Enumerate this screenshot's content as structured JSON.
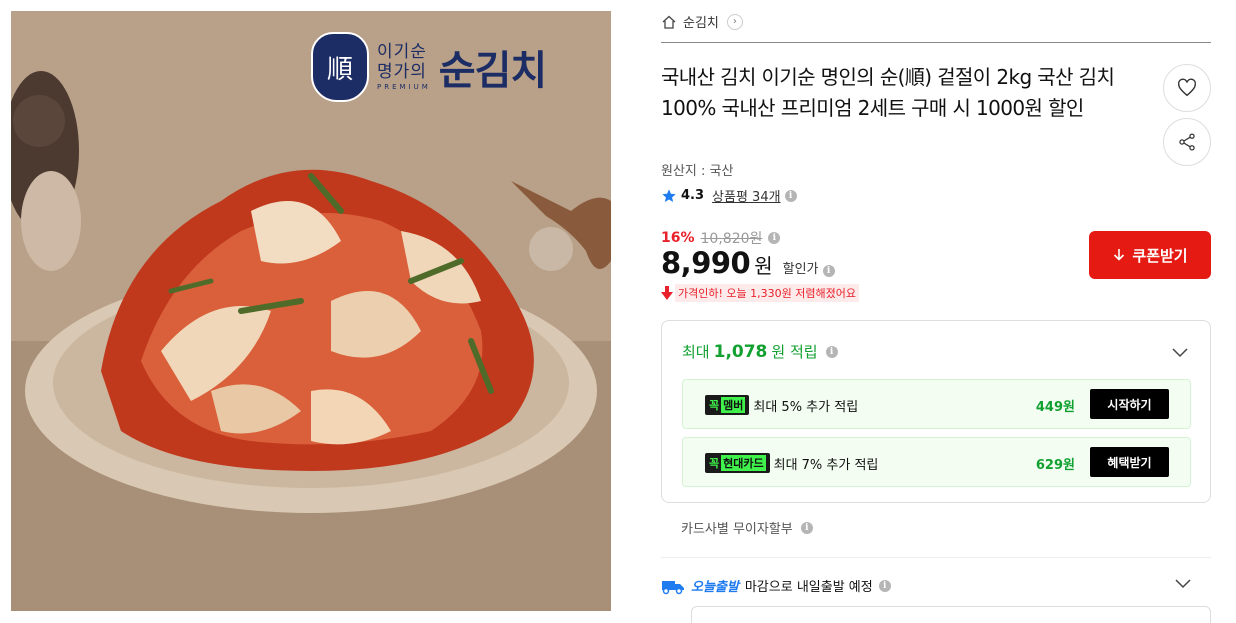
{
  "product_image": {
    "logo_main": "순김치",
    "logo_sub_line1": "이기순",
    "logo_sub_line2": "명가의",
    "logo_premium": "PREMIUM",
    "logo_seal_char": "順"
  },
  "breadcrumb": {
    "label": "순김치",
    "arrow": "›"
  },
  "product": {
    "title": "국내산 김치 이기순 명인의 순(順) 겉절이 2kg 국산 김치 100% 국내산 프리미엄 2세트 구매 시 1000원 할인",
    "origin": "원산지 : 국산",
    "rating": "4.3",
    "reviews": "상품평 34개"
  },
  "price": {
    "discount": "16%",
    "original": "10,820원",
    "sale": "8,990",
    "unit": "원",
    "sale_label": "할인가",
    "price_drop_note": "가격인하! 오늘 1,330원 저렴해졌어요"
  },
  "coupon_button": "쿠폰받기",
  "reward": {
    "prefix": "최대",
    "amount": "1,078",
    "suffix": "원 적립",
    "items": [
      {
        "badge_left": "꼭",
        "badge_right": "멤버",
        "text": "최대 5% 추가 적립",
        "amount": "449원",
        "button": "시작하기"
      },
      {
        "badge_left": "꼭",
        "badge_right": "현대카드",
        "text": "최대 7% 추가 적립",
        "amount": "629원",
        "button": "혜택받기"
      }
    ]
  },
  "installment": "카드사별 무이자할부",
  "delivery": {
    "brand": "오늘출발",
    "text": "마감으로 내일출발 예정"
  },
  "colors": {
    "accent_red": "#e51a12",
    "reward_green": "#12a130",
    "star_blue": "#1f7cf0"
  }
}
